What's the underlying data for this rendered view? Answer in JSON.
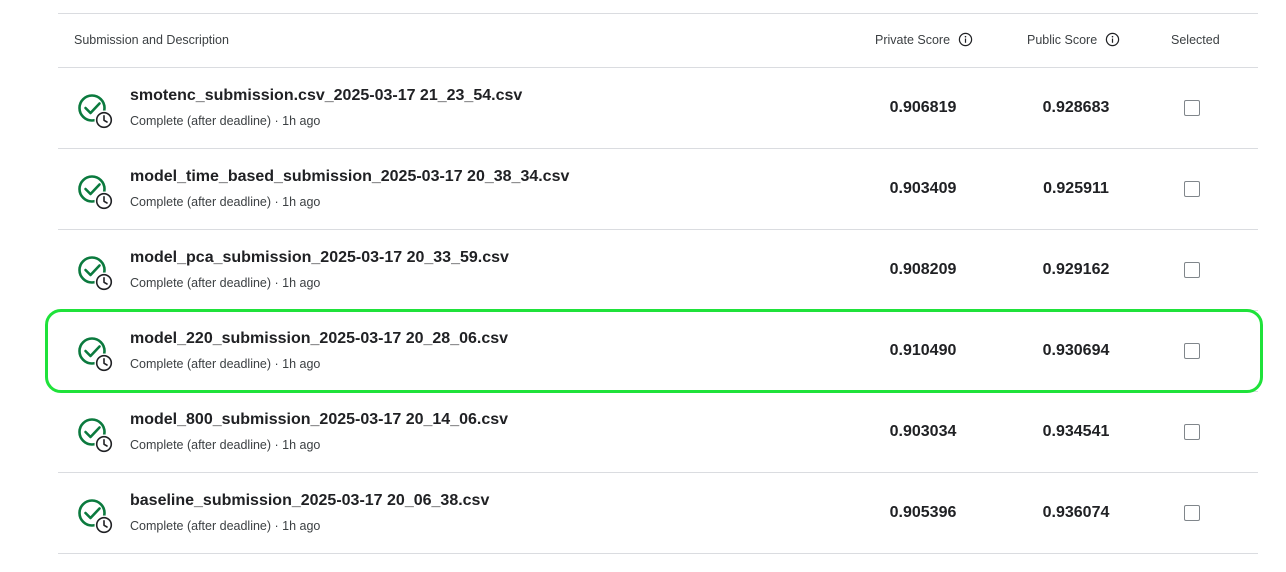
{
  "header": {
    "submission_label": "Submission and Description",
    "private_label": "Private Score",
    "public_label": "Public Score",
    "selected_label": "Selected"
  },
  "rows": [
    {
      "name": "smotenc_submission.csv_2025-03-17 21_23_54.csv",
      "status": "Complete (after deadline) · 1h ago",
      "private": "0.906819",
      "public": "0.928683"
    },
    {
      "name": "model_time_based_submission_2025-03-17 20_38_34.csv",
      "status": "Complete (after deadline) · 1h ago",
      "private": "0.903409",
      "public": "0.925911"
    },
    {
      "name": "model_pca_submission_2025-03-17 20_33_59.csv",
      "status": "Complete (after deadline) · 1h ago",
      "private": "0.908209",
      "public": "0.929162"
    },
    {
      "name": "model_220_submission_2025-03-17 20_28_06.csv",
      "status": "Complete (after deadline) · 1h ago",
      "private": "0.910490",
      "public": "0.930694"
    },
    {
      "name": "model_800_submission_2025-03-17 20_14_06.csv",
      "status": "Complete (after deadline) · 1h ago",
      "private": "0.903034",
      "public": "0.934541"
    },
    {
      "name": "baseline_submission_2025-03-17 20_06_38.csv",
      "status": "Complete (after deadline) · 1h ago",
      "private": "0.905396",
      "public": "0.936074"
    }
  ],
  "colors": {
    "status_green": "#0b7a3e",
    "highlight": "#1fe23a"
  },
  "icons": {
    "status": "check-circle-clock-icon",
    "info": "info-icon"
  }
}
